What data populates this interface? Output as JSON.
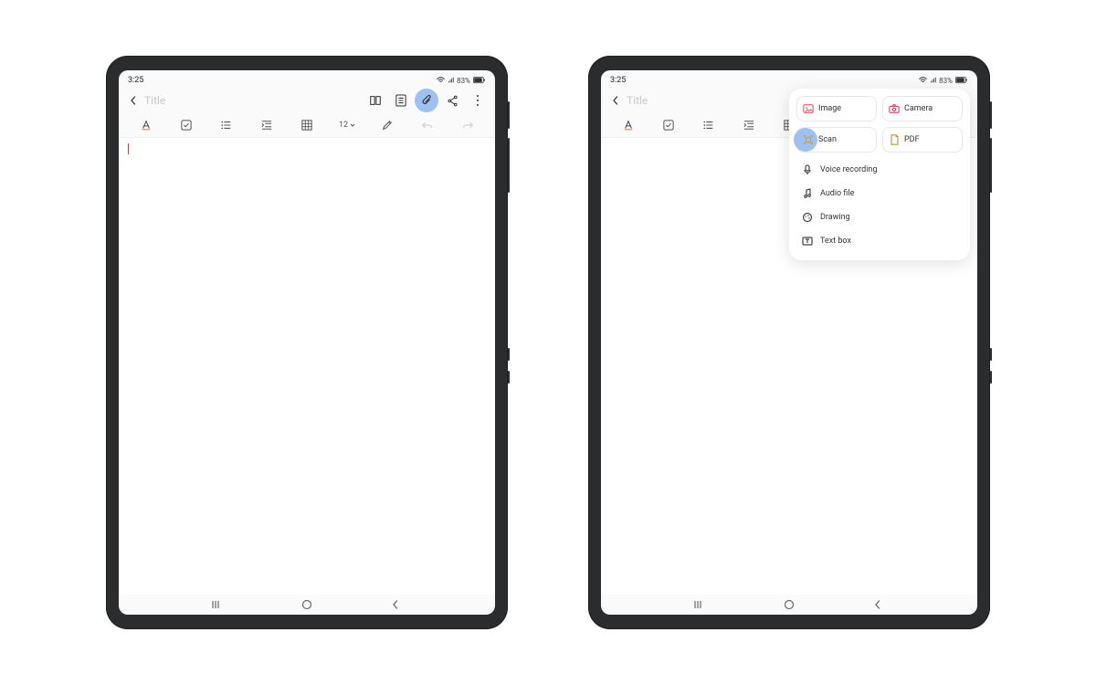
{
  "status": {
    "time": "3:25",
    "battery_label": "83%"
  },
  "header": {
    "title_placeholder": "Title",
    "actions": {
      "reading_mode": "reading-mode",
      "page_template": "page-template",
      "attach": "attach",
      "share": "share",
      "more": "more"
    }
  },
  "toolbar": {
    "font_size_label": "12",
    "tools": [
      "text-style",
      "checkbox",
      "list",
      "indent",
      "table",
      "font-size",
      "pen",
      "undo",
      "redo"
    ]
  },
  "navbar": {
    "recents": "recents",
    "home": "home",
    "back": "back"
  },
  "attach_menu": {
    "tiles": [
      {
        "key": "image",
        "label": "Image"
      },
      {
        "key": "camera",
        "label": "Camera"
      },
      {
        "key": "scan",
        "label": "Scan"
      },
      {
        "key": "pdf",
        "label": "PDF"
      }
    ],
    "items": [
      {
        "key": "voice",
        "label": "Voice recording"
      },
      {
        "key": "audio",
        "label": "Audio file"
      },
      {
        "key": "drawing",
        "label": "Drawing"
      },
      {
        "key": "textbox",
        "label": "Text box"
      }
    ]
  },
  "highlight": {
    "left_device": "attach",
    "right_device": "scan"
  }
}
